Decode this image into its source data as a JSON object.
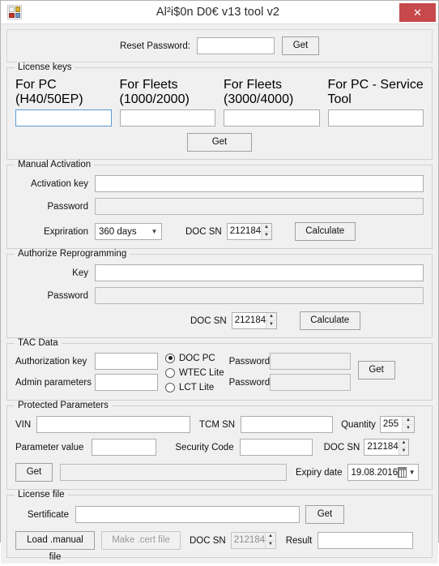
{
  "window": {
    "title": "Al²i$0n D0€ v13 tool v2",
    "icon": "app-grid-icon",
    "close_label": "✕",
    "accent_close_color": "#c8494b",
    "focus_border_color": "#5b9bd5"
  },
  "reset_panel": {
    "label": "Reset Password:",
    "value": "",
    "get_label": "Get"
  },
  "license_keys": {
    "caption": "License keys",
    "fields": [
      {
        "label": "For PC (H40/50EP)",
        "value": "",
        "focused": true
      },
      {
        "label": "For Fleets (1000/2000)",
        "value": "",
        "focused": false
      },
      {
        "label": "For Fleets (3000/4000)",
        "value": "",
        "focused": false
      },
      {
        "label": "For PC - Service Tool",
        "value": "",
        "focused": false
      }
    ],
    "get_label": "Get"
  },
  "manual_activation": {
    "caption": "Manual Activation",
    "activation_key_label": "Activation key",
    "activation_key_value": "",
    "password_label": "Password",
    "password_value": "",
    "expiration_label": "Expriration",
    "expiration_value": "360 days",
    "doc_sn_label": "DOC SN",
    "doc_sn_value": "212184",
    "calculate_label": "Calculate"
  },
  "authorize_reprogramming": {
    "caption": "Authorize Reprogramming",
    "key_label": "Key",
    "key_value": "",
    "password_label": "Password",
    "password_value": "",
    "doc_sn_label": "DOC SN",
    "doc_sn_value": "212184",
    "calculate_label": "Calculate"
  },
  "tac_data": {
    "caption": "TAC Data",
    "authorization_key_label": "Authorization key",
    "authorization_key_value": "",
    "admin_parameters_label": "Admin parameters",
    "admin_parameters_value": "",
    "radios": [
      {
        "label": "DOC PC",
        "selected": true
      },
      {
        "label": "WTEC Lite",
        "selected": false
      },
      {
        "label": "LCT Lite",
        "selected": false
      }
    ],
    "password1_label": "Password",
    "password1_value": "",
    "password2_label": "Password",
    "password2_value": "",
    "get_label": "Get"
  },
  "protected_parameters": {
    "caption": "Protected Parameters",
    "vin_label": "VIN",
    "vin_value": "",
    "tcm_sn_label": "TCM SN",
    "tcm_sn_value": "",
    "quantity_label": "Quantity",
    "quantity_value": "255",
    "parameter_value_label": "Parameter value",
    "parameter_value_value": "",
    "security_code_label": "Security Code",
    "security_code_value": "",
    "doc_sn_label": "DOC SN",
    "doc_sn_value": "212184",
    "get_label": "Get",
    "result_value": "",
    "expiry_date_label": "Expiry date",
    "expiry_date_value": "19.08.2016"
  },
  "license_file": {
    "caption": "License file",
    "sertificate_label": "Sertificate",
    "sertificate_value": "",
    "get_label": "Get",
    "load_manual_label": "Load .manual file",
    "make_cert_label": "Make .cert file",
    "doc_sn_label": "DOC SN",
    "doc_sn_value": "212184",
    "result_label": "Result",
    "result_value": ""
  }
}
